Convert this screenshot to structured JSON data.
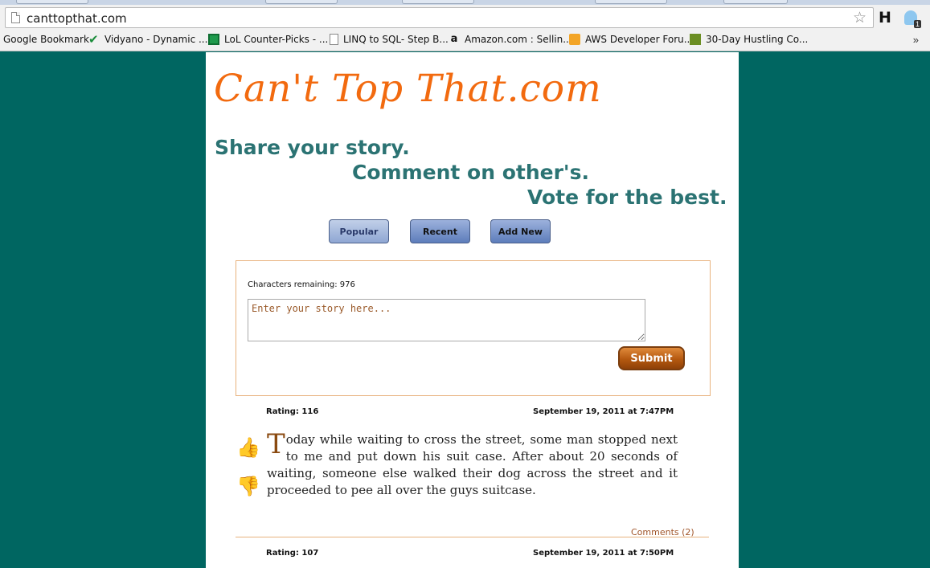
{
  "browser": {
    "url": "canttopthat.com",
    "bookmarks": [
      {
        "label": "Google Bookmark",
        "icon": "none",
        "color": "#f1f1f1"
      },
      {
        "label": "Vidyano - Dynamic ...",
        "icon": "vidyano-check-icon",
        "color": "#1a8c3a"
      },
      {
        "label": "LoL Counter-Picks - ...",
        "icon": "spreadsheet-icon",
        "color": "#1e9a4c"
      },
      {
        "label": "LINQ to SQL- Step B...",
        "icon": "page-icon",
        "color": "#ffffff"
      },
      {
        "label": "Amazon.com : Sellin...",
        "icon": "amazon-icon",
        "color": "#222222"
      },
      {
        "label": "AWS Developer Foru...",
        "icon": "aws-cube-icon",
        "color": "#f3a527"
      },
      {
        "label": "30-Day Hustling Co...",
        "icon": "intv-icon",
        "color": "#6b8e23"
      }
    ],
    "more_label": "»",
    "ext_h": "H",
    "ext_badge": "1"
  },
  "site": {
    "logo": "Can't Top That.com",
    "tagline1": "Share your story.",
    "tagline2": "Comment on other's.",
    "tagline3": "Vote for the best.",
    "nav": {
      "popular": "Popular",
      "recent": "Recent",
      "add_new": "Add New"
    },
    "form": {
      "chars_remaining": "Characters remaining: 976",
      "placeholder": "Enter your story here...",
      "submit": "Submit"
    },
    "stories": [
      {
        "rating": "Rating: 116",
        "date": "September 19, 2011 at 7:47PM",
        "dropcap": "T",
        "text": "oday while waiting to cross the street, some man stopped next to me and put down his suit case. After about 20 seconds of waiting, someone else walked their dog across the street and it proceeded to pee all over the guys suitcase.",
        "comments": "Comments (2)"
      },
      {
        "rating": "Rating: 107",
        "date": "September 19, 2011 at 7:50PM"
      }
    ]
  }
}
